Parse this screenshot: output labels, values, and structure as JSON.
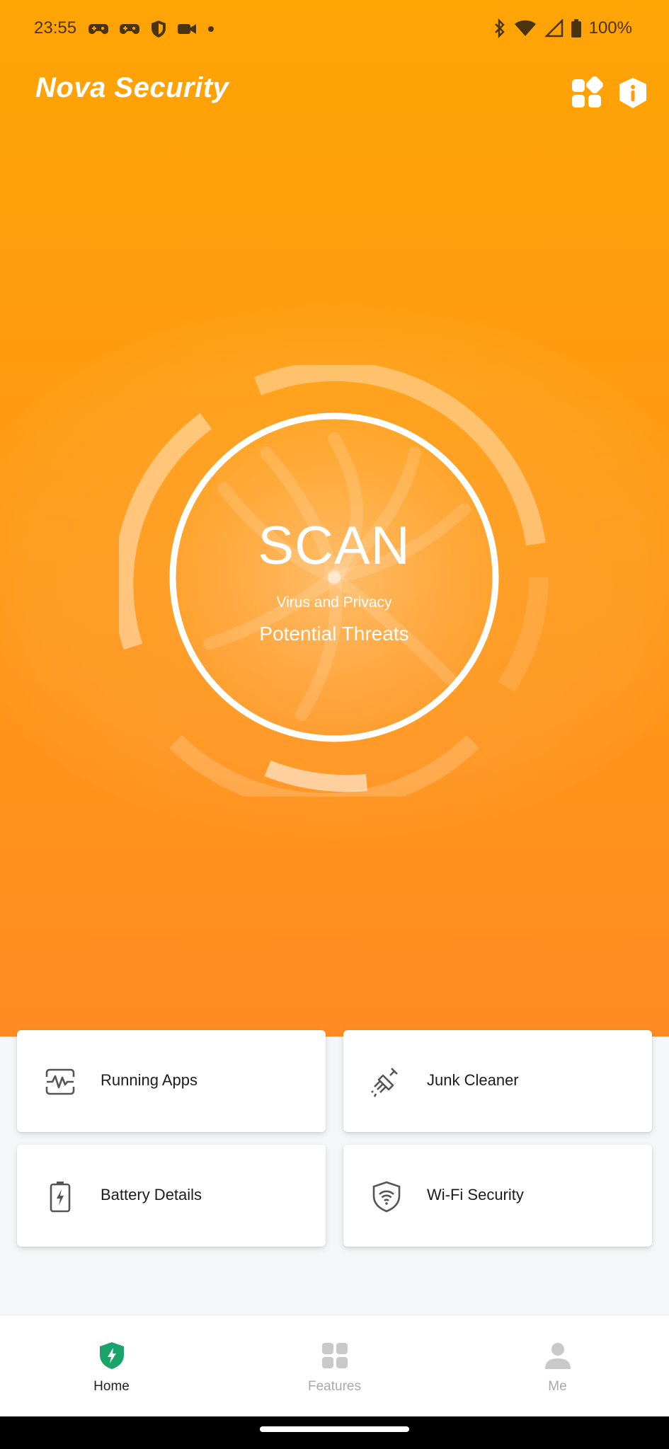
{
  "status_bar": {
    "time": "23:55",
    "left_icons": [
      "game-controller-icon",
      "game-controller-icon",
      "shield-icon",
      "video-camera-icon",
      "dot-icon"
    ],
    "right_icons": [
      "bluetooth-icon",
      "wifi-icon",
      "cell-signal-icon",
      "battery-icon"
    ],
    "battery": "100%"
  },
  "header": {
    "title": "Nova Security",
    "grid_icon": "grid-apps-icon",
    "info_icon": "info-shield-icon"
  },
  "scan": {
    "title": "SCAN",
    "subtitle": "Virus and Privacy",
    "caption": "Potential Threats"
  },
  "features": [
    {
      "label": "Running Apps",
      "icon": "activity-monitor-icon"
    },
    {
      "label": "Junk Cleaner",
      "icon": "broom-icon"
    },
    {
      "label": "Battery Details",
      "icon": "battery-charging-icon"
    },
    {
      "label": "Wi-Fi Security",
      "icon": "wifi-shield-icon"
    }
  ],
  "bottom_nav": {
    "items": [
      {
        "label": "Home",
        "icon": "home-shield-icon",
        "active": true
      },
      {
        "label": "Features",
        "icon": "features-grid-icon",
        "active": false
      },
      {
        "label": "Me",
        "icon": "profile-icon",
        "active": false
      }
    ]
  },
  "colors": {
    "hero_top": "#ffa405",
    "hero_bottom": "#ff8c22",
    "active_nav": "#1aa36b",
    "inactive_nav": "#bdbdbd"
  }
}
